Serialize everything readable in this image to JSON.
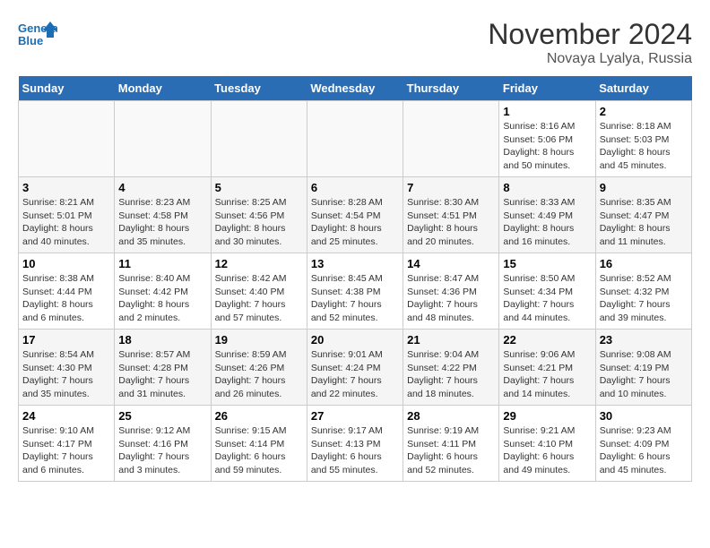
{
  "header": {
    "logo_line1": "General",
    "logo_line2": "Blue",
    "month": "November 2024",
    "location": "Novaya Lyalya, Russia"
  },
  "weekdays": [
    "Sunday",
    "Monday",
    "Tuesday",
    "Wednesday",
    "Thursday",
    "Friday",
    "Saturday"
  ],
  "weeks": [
    [
      {
        "day": "",
        "info": ""
      },
      {
        "day": "",
        "info": ""
      },
      {
        "day": "",
        "info": ""
      },
      {
        "day": "",
        "info": ""
      },
      {
        "day": "",
        "info": ""
      },
      {
        "day": "1",
        "info": "Sunrise: 8:16 AM\nSunset: 5:06 PM\nDaylight: 8 hours\nand 50 minutes."
      },
      {
        "day": "2",
        "info": "Sunrise: 8:18 AM\nSunset: 5:03 PM\nDaylight: 8 hours\nand 45 minutes."
      }
    ],
    [
      {
        "day": "3",
        "info": "Sunrise: 8:21 AM\nSunset: 5:01 PM\nDaylight: 8 hours\nand 40 minutes."
      },
      {
        "day": "4",
        "info": "Sunrise: 8:23 AM\nSunset: 4:58 PM\nDaylight: 8 hours\nand 35 minutes."
      },
      {
        "day": "5",
        "info": "Sunrise: 8:25 AM\nSunset: 4:56 PM\nDaylight: 8 hours\nand 30 minutes."
      },
      {
        "day": "6",
        "info": "Sunrise: 8:28 AM\nSunset: 4:54 PM\nDaylight: 8 hours\nand 25 minutes."
      },
      {
        "day": "7",
        "info": "Sunrise: 8:30 AM\nSunset: 4:51 PM\nDaylight: 8 hours\nand 20 minutes."
      },
      {
        "day": "8",
        "info": "Sunrise: 8:33 AM\nSunset: 4:49 PM\nDaylight: 8 hours\nand 16 minutes."
      },
      {
        "day": "9",
        "info": "Sunrise: 8:35 AM\nSunset: 4:47 PM\nDaylight: 8 hours\nand 11 minutes."
      }
    ],
    [
      {
        "day": "10",
        "info": "Sunrise: 8:38 AM\nSunset: 4:44 PM\nDaylight: 8 hours\nand 6 minutes."
      },
      {
        "day": "11",
        "info": "Sunrise: 8:40 AM\nSunset: 4:42 PM\nDaylight: 8 hours\nand 2 minutes."
      },
      {
        "day": "12",
        "info": "Sunrise: 8:42 AM\nSunset: 4:40 PM\nDaylight: 7 hours\nand 57 minutes."
      },
      {
        "day": "13",
        "info": "Sunrise: 8:45 AM\nSunset: 4:38 PM\nDaylight: 7 hours\nand 52 minutes."
      },
      {
        "day": "14",
        "info": "Sunrise: 8:47 AM\nSunset: 4:36 PM\nDaylight: 7 hours\nand 48 minutes."
      },
      {
        "day": "15",
        "info": "Sunrise: 8:50 AM\nSunset: 4:34 PM\nDaylight: 7 hours\nand 44 minutes."
      },
      {
        "day": "16",
        "info": "Sunrise: 8:52 AM\nSunset: 4:32 PM\nDaylight: 7 hours\nand 39 minutes."
      }
    ],
    [
      {
        "day": "17",
        "info": "Sunrise: 8:54 AM\nSunset: 4:30 PM\nDaylight: 7 hours\nand 35 minutes."
      },
      {
        "day": "18",
        "info": "Sunrise: 8:57 AM\nSunset: 4:28 PM\nDaylight: 7 hours\nand 31 minutes."
      },
      {
        "day": "19",
        "info": "Sunrise: 8:59 AM\nSunset: 4:26 PM\nDaylight: 7 hours\nand 26 minutes."
      },
      {
        "day": "20",
        "info": "Sunrise: 9:01 AM\nSunset: 4:24 PM\nDaylight: 7 hours\nand 22 minutes."
      },
      {
        "day": "21",
        "info": "Sunrise: 9:04 AM\nSunset: 4:22 PM\nDaylight: 7 hours\nand 18 minutes."
      },
      {
        "day": "22",
        "info": "Sunrise: 9:06 AM\nSunset: 4:21 PM\nDaylight: 7 hours\nand 14 minutes."
      },
      {
        "day": "23",
        "info": "Sunrise: 9:08 AM\nSunset: 4:19 PM\nDaylight: 7 hours\nand 10 minutes."
      }
    ],
    [
      {
        "day": "24",
        "info": "Sunrise: 9:10 AM\nSunset: 4:17 PM\nDaylight: 7 hours\nand 6 minutes."
      },
      {
        "day": "25",
        "info": "Sunrise: 9:12 AM\nSunset: 4:16 PM\nDaylight: 7 hours\nand 3 minutes."
      },
      {
        "day": "26",
        "info": "Sunrise: 9:15 AM\nSunset: 4:14 PM\nDaylight: 6 hours\nand 59 minutes."
      },
      {
        "day": "27",
        "info": "Sunrise: 9:17 AM\nSunset: 4:13 PM\nDaylight: 6 hours\nand 55 minutes."
      },
      {
        "day": "28",
        "info": "Sunrise: 9:19 AM\nSunset: 4:11 PM\nDaylight: 6 hours\nand 52 minutes."
      },
      {
        "day": "29",
        "info": "Sunrise: 9:21 AM\nSunset: 4:10 PM\nDaylight: 6 hours\nand 49 minutes."
      },
      {
        "day": "30",
        "info": "Sunrise: 9:23 AM\nSunset: 4:09 PM\nDaylight: 6 hours\nand 45 minutes."
      }
    ]
  ]
}
